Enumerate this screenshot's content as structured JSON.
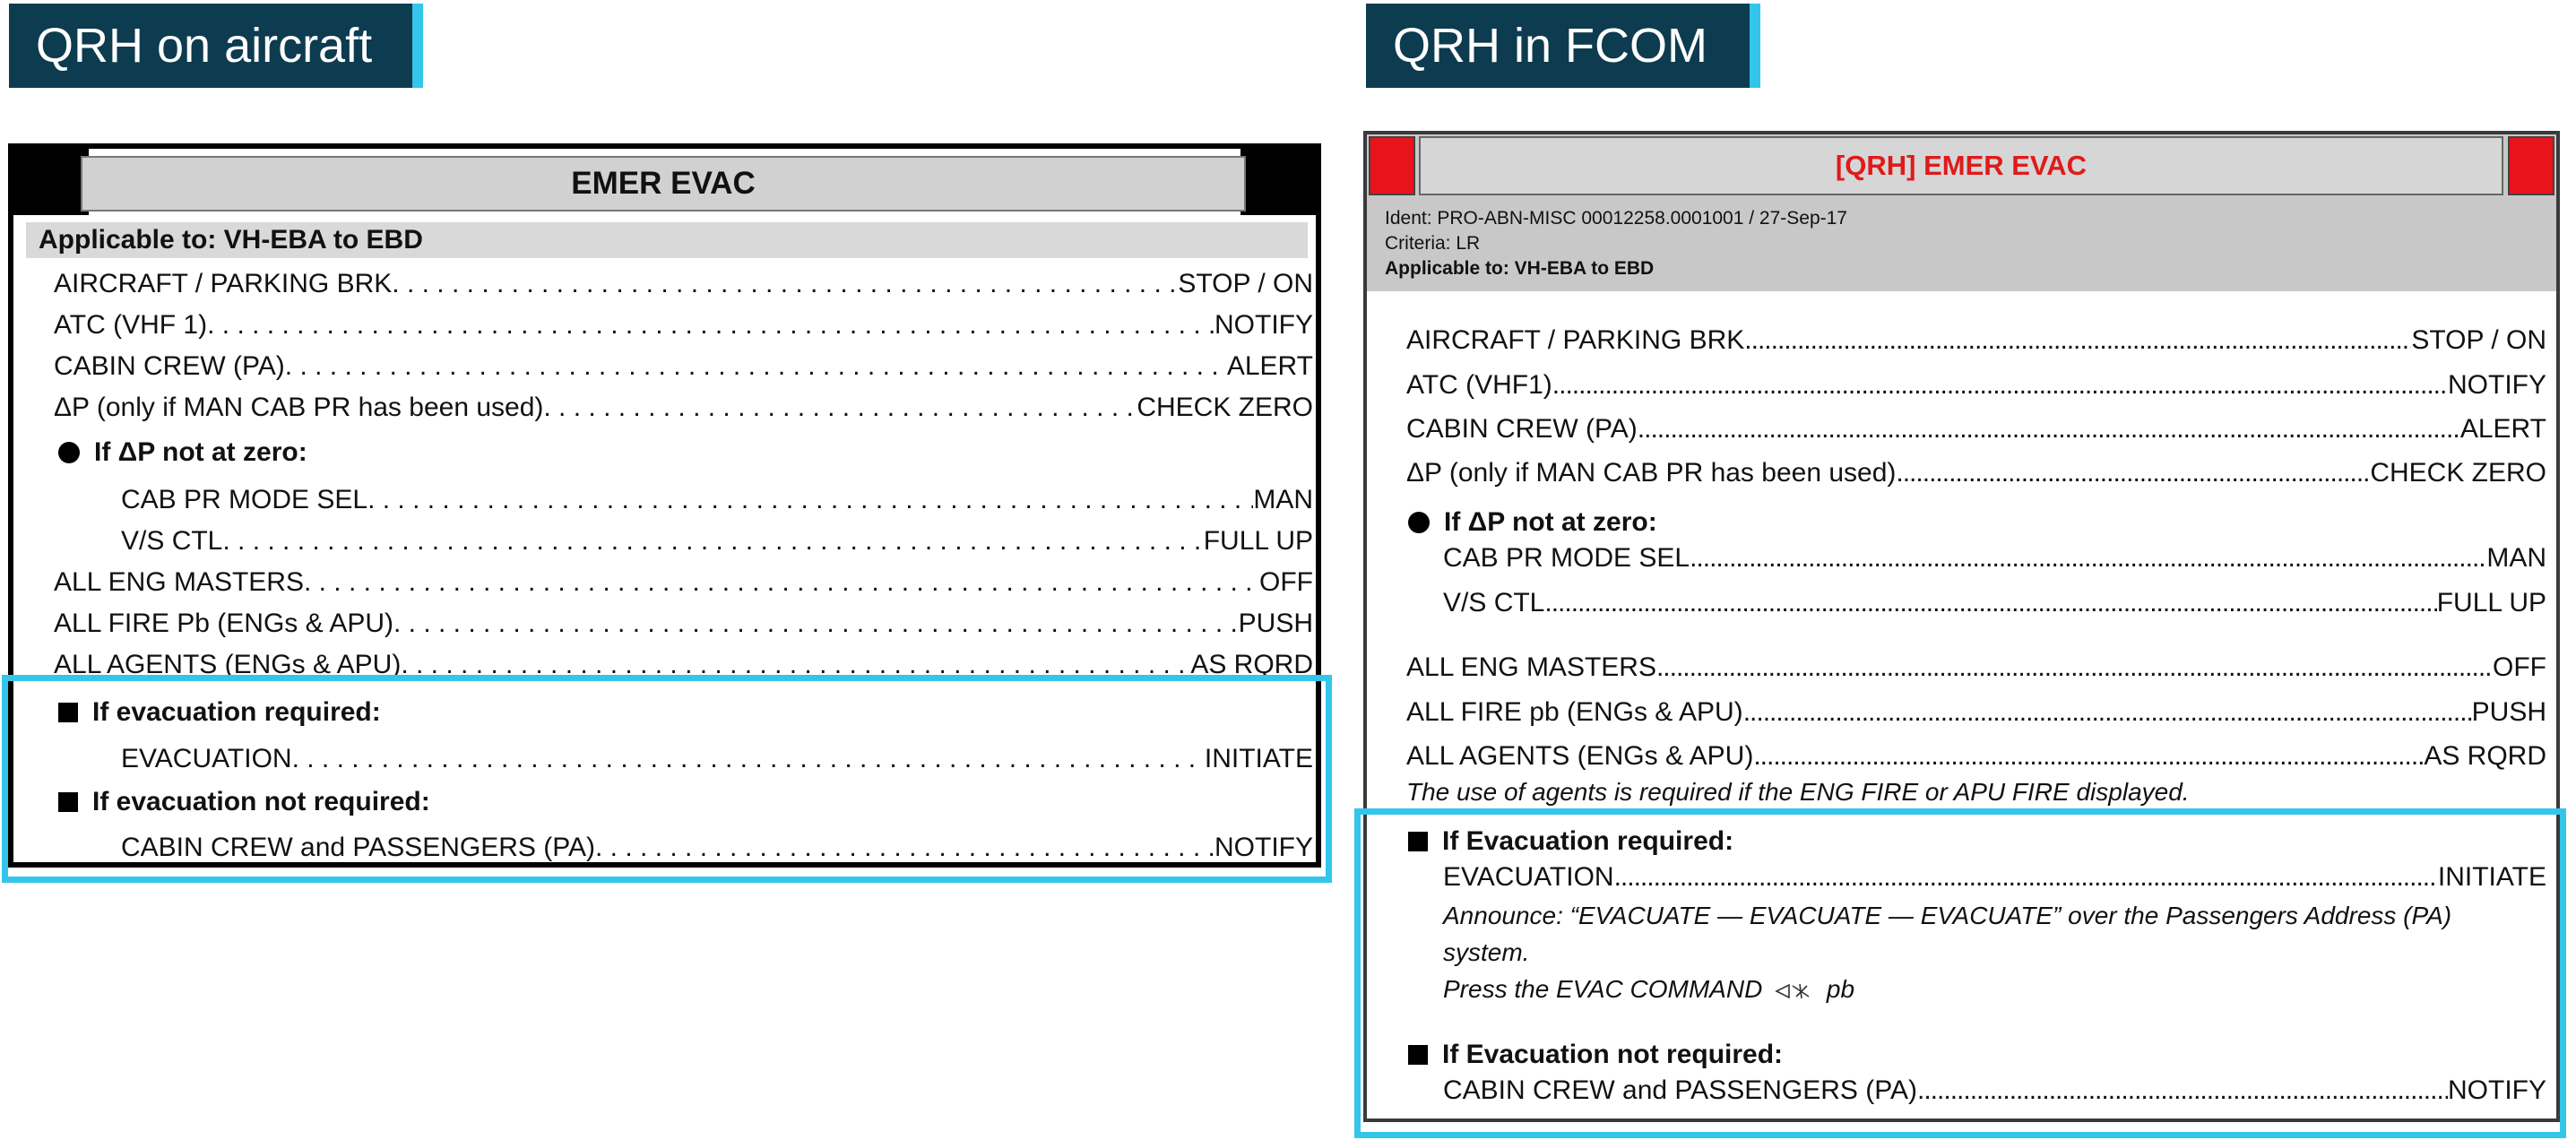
{
  "labels": {
    "left_tag": "QRH on aircraft",
    "right_tag": "QRH in FCOM"
  },
  "left_panel": {
    "title": "EMER EVAC",
    "applicable": "Applicable to: VH-EBA to EBD",
    "items": [
      {
        "label": "AIRCRAFT / PARKING BRK",
        "value": "STOP / ON"
      },
      {
        "label": "ATC (VHF 1)",
        "value": "NOTIFY"
      },
      {
        "label": "CABIN CREW (PA)",
        "value": "ALERT"
      },
      {
        "label": "ΔP (only if MAN CAB PR has been used)",
        "value": "CHECK ZERO"
      }
    ],
    "condition_dp": "If ΔP not at zero:",
    "dp_items": [
      {
        "label": "CAB PR MODE SEL",
        "value": "MAN"
      },
      {
        "label": "V/S CTL",
        "value": "FULL UP"
      }
    ],
    "items_after": [
      {
        "label": "ALL ENG MASTERS",
        "value": "OFF"
      },
      {
        "label": "ALL FIRE Pb (ENGs & APU)",
        "value": "PUSH"
      },
      {
        "label": "ALL AGENTS (ENGs & APU)",
        "value": "AS RQRD"
      }
    ],
    "condition_evac": "If evacuation required:",
    "evac_item": {
      "label": "EVACUATION",
      "value": "INITIATE"
    },
    "condition_noevac": "If evacuation not required:",
    "noevac_item": {
      "label": "CABIN CREW and PASSENGERS (PA)",
      "value": "NOTIFY"
    }
  },
  "right_panel": {
    "title": "[QRH] EMER EVAC",
    "ident": "Ident: PRO-ABN-MISC 00012258.0001001 / 27-Sep-17",
    "criteria": "Criteria: LR",
    "applicable": "Applicable to: VH-EBA to EBD",
    "items": [
      {
        "label": "AIRCRAFT / PARKING BRK",
        "value": "STOP / ON"
      },
      {
        "label": "ATC (VHF1)",
        "value": "NOTIFY"
      },
      {
        "label": "CABIN CREW (PA)",
        "value": "ALERT"
      },
      {
        "label": "ΔP (only if MAN CAB PR has been used)",
        "value": "CHECK ZERO"
      }
    ],
    "condition_dp": "If ΔP not at zero:",
    "dp_items": [
      {
        "label": "CAB PR MODE SEL",
        "value": "MAN"
      },
      {
        "label": "V/S CTL",
        "value": "FULL UP"
      }
    ],
    "items_after": [
      {
        "label": "ALL ENG MASTERS",
        "value": "OFF"
      },
      {
        "label": "ALL FIRE pb (ENGs & APU)",
        "value": "PUSH"
      },
      {
        "label": "ALL AGENTS (ENGs & APU)",
        "value": "AS RQRD"
      }
    ],
    "agents_note": "The use of agents is required if the ENG FIRE or APU FIRE displayed.",
    "condition_evac": "If Evacuation required:",
    "evac_item": {
      "label": "EVACUATION",
      "value": "INITIATE"
    },
    "announce_line1": "Announce: “EVACUATE — EVACUATE — EVACUATE” over the Passengers Address (PA)",
    "announce_line2": "system.",
    "press_before": "Press the EVAC COMMAND",
    "press_after": "pb",
    "condition_noevac": "If Evacuation not required:",
    "noevac_item": {
      "label": "CABIN CREW and PASSENGERS (PA)",
      "value": "NOTIFY"
    }
  },
  "colors": {
    "tag_bg": "#0d3b4f",
    "tag_accent": "#33c6ea",
    "highlight": "#33c6ea",
    "red": "#e8141c"
  }
}
